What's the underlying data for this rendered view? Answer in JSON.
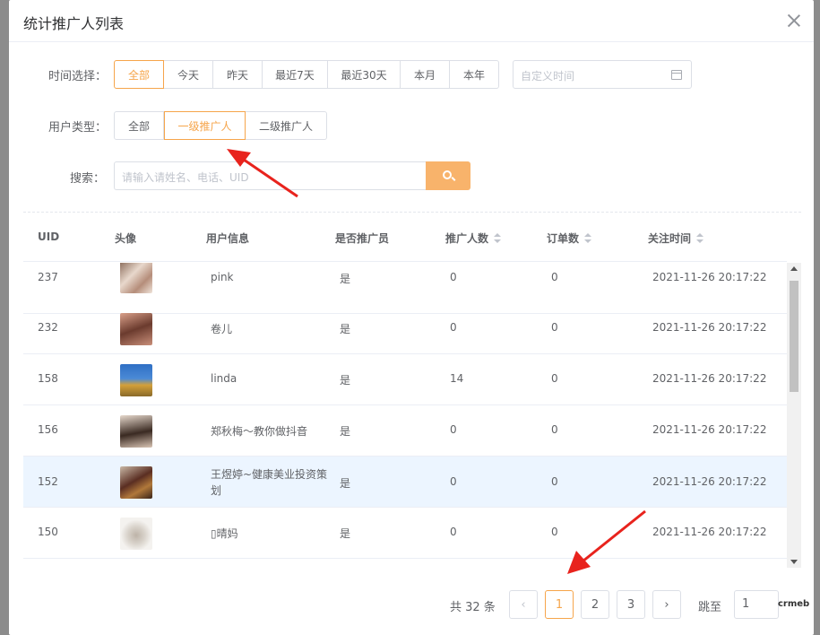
{
  "modal": {
    "title": "统计推广人列表"
  },
  "filters": {
    "time_label": "时间选择：",
    "time_options": [
      "全部",
      "今天",
      "昨天",
      "最近7天",
      "最近30天",
      "本月",
      "本年"
    ],
    "date_placeholder": "自定义时间",
    "user_type_label": "用户类型：",
    "user_type_options": [
      "全部",
      "一级推广人",
      "二级推广人"
    ],
    "search_label": "搜索：",
    "search_placeholder": "请输入请姓名、电话、UID"
  },
  "table": {
    "columns": [
      "UID",
      "头像",
      "用户信息",
      "是否推广员",
      "推广人数",
      "订单数",
      "关注时间"
    ],
    "rows": [
      {
        "uid": "237",
        "name": "pink",
        "promoter": "是",
        "count": "0",
        "orders": "0",
        "time": "2021-11-26 20:17:22"
      },
      {
        "uid": "232",
        "name": "卷儿",
        "promoter": "是",
        "count": "0",
        "orders": "0",
        "time": "2021-11-26 20:17:22"
      },
      {
        "uid": "158",
        "name": "linda",
        "promoter": "是",
        "count": "14",
        "orders": "0",
        "time": "2021-11-26 20:17:22"
      },
      {
        "uid": "156",
        "name": "郑秋梅～教你做抖音",
        "promoter": "是",
        "count": "0",
        "orders": "0",
        "time": "2021-11-26 20:17:22"
      },
      {
        "uid": "152",
        "name": "王煜婷~健康美业投资策",
        "name2": "划",
        "promoter": "是",
        "count": "0",
        "orders": "0",
        "time": "2021-11-26 20:17:22"
      },
      {
        "uid": "150",
        "name": "▯晴妈",
        "promoter": "是",
        "count": "0",
        "orders": "0",
        "time": "2021-11-26 20:17:22"
      }
    ]
  },
  "pagination": {
    "total": "共 32 条",
    "prev": "‹",
    "pages": [
      "1",
      "2",
      "3"
    ],
    "next": "›",
    "jump_label": "跳至",
    "jump_value": "1"
  },
  "watermark": "crmeb",
  "colors": {
    "accent": "#f6a54b",
    "arrow": "#e8231d",
    "highlight_row": "#ecf5ff"
  }
}
